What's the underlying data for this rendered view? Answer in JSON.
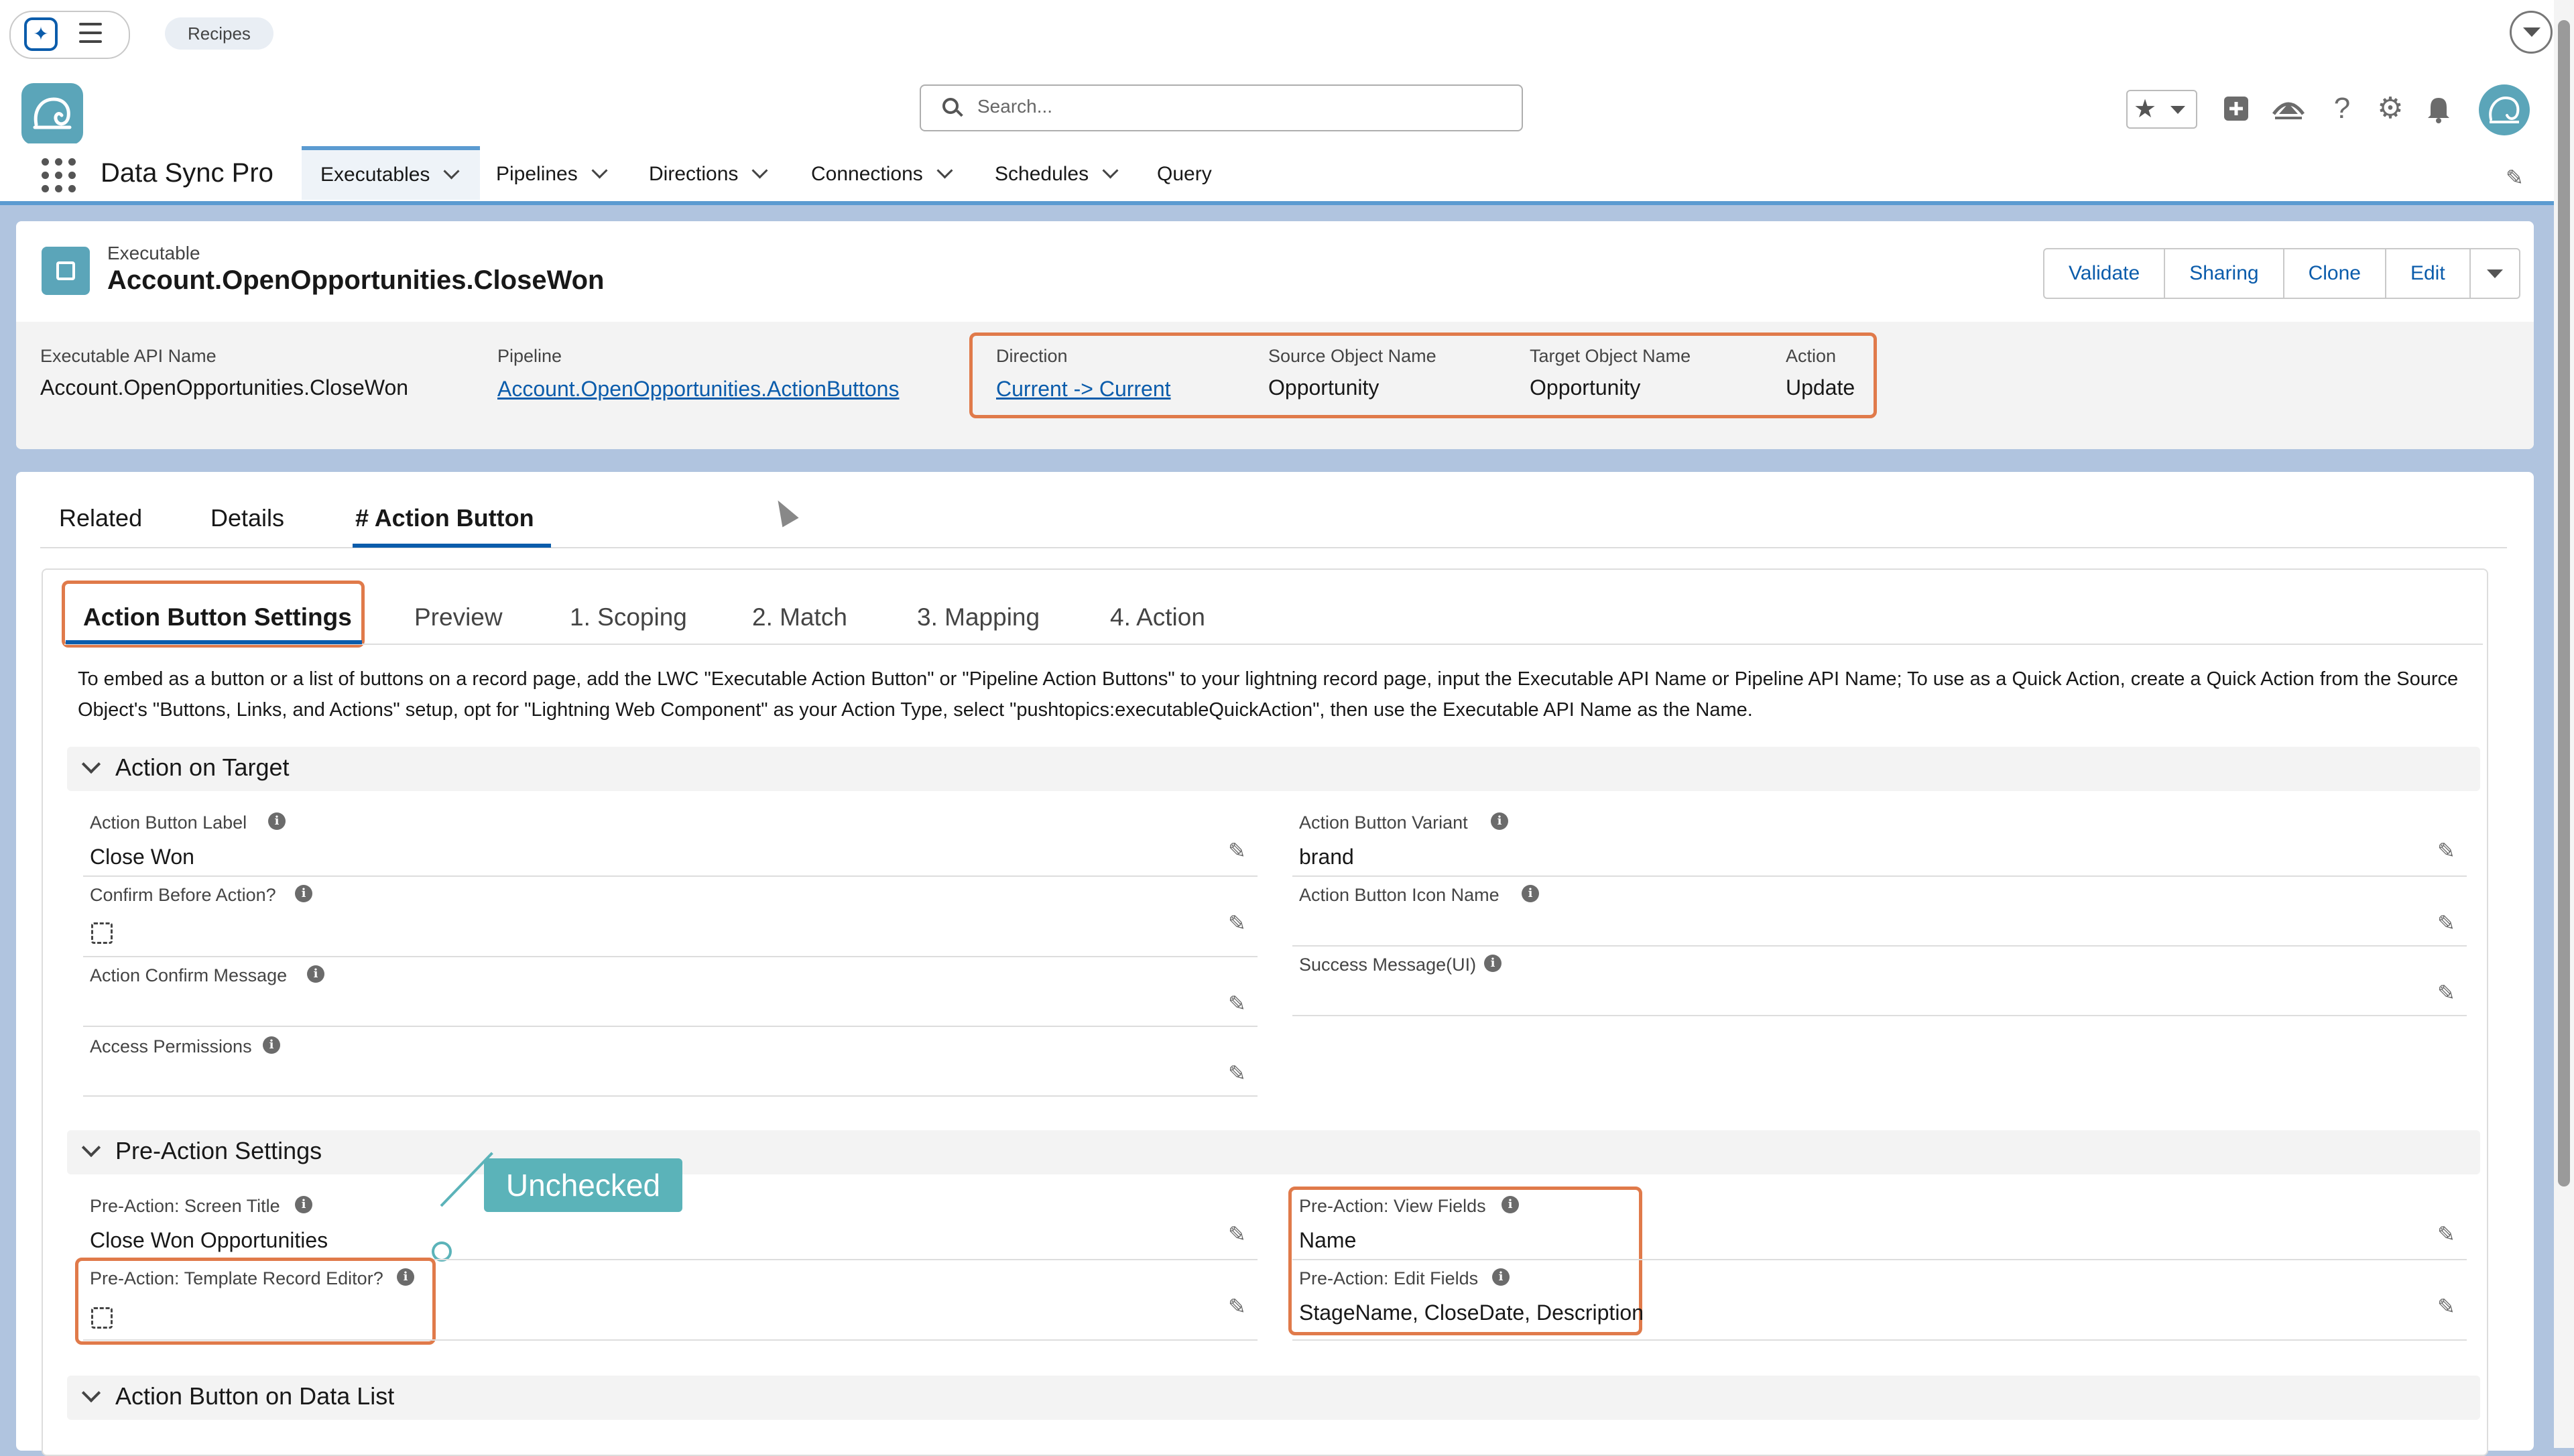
{
  "topbar": {
    "chip_label": "Recipes"
  },
  "header": {
    "search_placeholder": "Search..."
  },
  "nav": {
    "app_name": "Data Sync Pro",
    "tabs": [
      "Executables",
      "Pipelines",
      "Directions",
      "Connections",
      "Schedules",
      "Query"
    ]
  },
  "record": {
    "type": "Executable",
    "name": "Account.OpenOpportunities.CloseWon",
    "buttons": [
      "Validate",
      "Sharing",
      "Clone",
      "Edit"
    ],
    "highlights": {
      "api_name_label": "Executable API Name",
      "api_name_value": "Account.OpenOpportunities.CloseWon",
      "pipeline_label": "Pipeline",
      "pipeline_value": "Account.OpenOpportunities.ActionButtons",
      "direction_label": "Direction",
      "direction_value": "Current -> Current",
      "source_label": "Source Object Name",
      "source_value": "Opportunity",
      "target_label": "Target Object Name",
      "target_value": "Opportunity",
      "action_label": "Action",
      "action_value": "Update"
    }
  },
  "record_tabs": [
    "Related",
    "Details",
    "# Action Button"
  ],
  "sub_tabs": [
    "Action Button Settings",
    "Preview",
    "1. Scoping",
    "2. Match",
    "3. Mapping",
    "4. Action"
  ],
  "instructions": "To embed as a button or a list of buttons on a record page, add the LWC \"Executable Action Button\" or \"Pipeline Action Buttons\" to your lightning record page, input the Executable API Name or Pipeline API Name; To use as a Quick Action, create a Quick Action from the Source Object's \"Buttons, Links, and Actions\" setup, opt for \"Lightning Web Component\" as your Action Type, select \"pushtopics:executableQuickAction\", then use the Executable API Name as the Name.",
  "sections": {
    "action_on_target": {
      "title": "Action on Target",
      "action_button_label": {
        "label": "Action Button Label",
        "value": "Close Won"
      },
      "confirm_before_action": {
        "label": "Confirm Before Action?"
      },
      "action_confirm_message": {
        "label": "Action Confirm Message"
      },
      "access_permissions": {
        "label": "Access Permissions"
      },
      "action_button_variant": {
        "label": "Action Button Variant",
        "value": "brand"
      },
      "action_button_icon_name": {
        "label": "Action Button Icon Name"
      },
      "success_message": {
        "label": "Success Message(UI)"
      }
    },
    "pre_action": {
      "title": "Pre-Action Settings",
      "screen_title": {
        "label": "Pre-Action: Screen Title",
        "value": "Close Won Opportunities"
      },
      "template_record_editor": {
        "label": "Pre-Action: Template Record Editor?"
      },
      "view_fields": {
        "label": "Pre-Action: View Fields",
        "value": "Name"
      },
      "edit_fields": {
        "label": "Pre-Action: Edit Fields",
        "value": "StageName, CloseDate, Description"
      }
    },
    "data_list": {
      "title": "Action Button on Data List"
    }
  },
  "callout": {
    "text": "Unchecked"
  },
  "colors": {
    "brand": "#0b5cab",
    "highlight": "#e07a4a",
    "callout": "#5bb3b9",
    "accent": "#5ba5b9"
  }
}
